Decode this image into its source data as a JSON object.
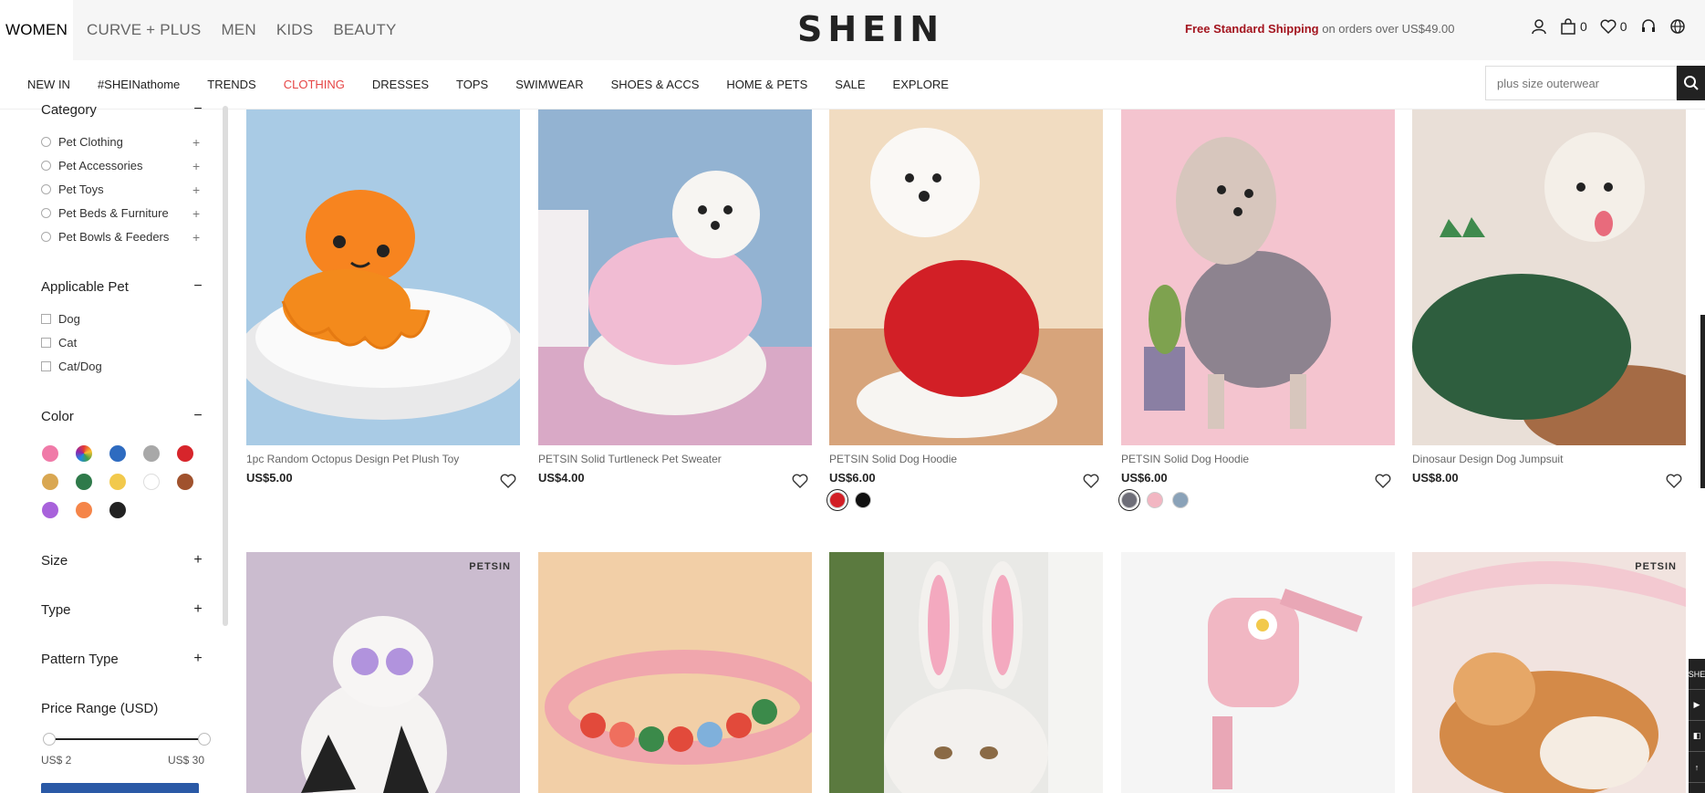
{
  "topnav": [
    "WOMEN",
    "CURVE + PLUS",
    "MEN",
    "KIDS",
    "BEAUTY"
  ],
  "logo": "SHEIN",
  "shipping": {
    "free": "Free Standard Shipping",
    "rest": " on orders over US$49.00"
  },
  "header_icons": {
    "bag_count": "0",
    "wishlist_count": "0"
  },
  "catnav": [
    "NEW IN",
    "#SHEINathome",
    "TRENDS",
    "CLOTHING",
    "DRESSES",
    "TOPS",
    "SWIMWEAR",
    "SHOES & ACCS",
    "HOME & PETS",
    "SALE",
    "EXPLORE"
  ],
  "catnav_active": "CLOTHING",
  "search": {
    "placeholder": "plus size outerwear"
  },
  "filters": {
    "category": {
      "title": "Category",
      "toggle": "−",
      "items": [
        "Pet Clothing",
        "Pet Accessories",
        "Pet Toys",
        "Pet Beds & Furniture",
        "Pet Bowls & Feeders"
      ]
    },
    "applicable_pet": {
      "title": "Applicable Pet",
      "toggle": "−",
      "items": [
        "Dog",
        "Cat",
        "Cat/Dog"
      ]
    },
    "color": {
      "title": "Color",
      "toggle": "−",
      "swatches": [
        "#f07aa8",
        "multicolor",
        "#2e6bc0",
        "#a8a8a8",
        "#d7252b",
        "#d9a752",
        "#2f7a4a",
        "#f2c94c",
        "#ffffff",
        "#a0522d",
        "#a862db",
        "#f58549",
        "#222222"
      ]
    },
    "size": {
      "title": "Size",
      "toggle": "+"
    },
    "type": {
      "title": "Type",
      "toggle": "+"
    },
    "pattern_type": {
      "title": "Pattern Type",
      "toggle": "+"
    },
    "price_range": {
      "title": "Price Range (USD)",
      "min_label": "US$ 2",
      "max_label": "US$ 30"
    }
  },
  "products": [
    {
      "title": "1pc Random Octopus Design Pet Plush Toy",
      "price": "US$5.00",
      "colors": []
    },
    {
      "title": "PETSIN Solid Turtleneck Pet Sweater",
      "price": "US$4.00",
      "colors": []
    },
    {
      "title": "PETSIN Solid Dog Hoodie",
      "price": "US$6.00",
      "colors": [
        "#d21f26",
        "#111111"
      ]
    },
    {
      "title": "PETSIN Solid Dog Hoodie",
      "price": "US$6.00",
      "colors": [
        "#6e6e78",
        "#f2b6c2",
        "#8aa2b8"
      ]
    },
    {
      "title": "Dinosaur Design Dog Jumpsuit",
      "price": "US$8.00",
      "colors": []
    }
  ],
  "row2_badge": "PETSIN",
  "right_tools": [
    "SHE",
    "▶",
    "◧",
    "↑"
  ]
}
